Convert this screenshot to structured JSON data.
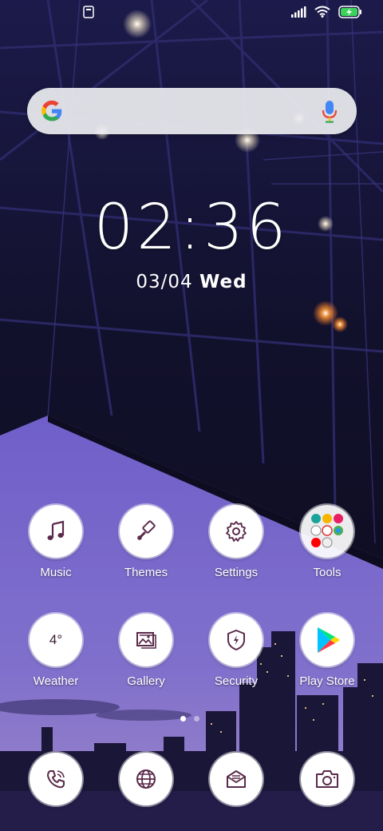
{
  "status": {
    "signal_icon": "signal-icon",
    "wifi_icon": "wifi-icon",
    "battery_icon": "battery-charging-icon",
    "battery_color": "#3bd35a"
  },
  "search": {
    "logo_icon": "google-g-icon",
    "mic_icon": "mic-icon"
  },
  "clock": {
    "time": "02:36",
    "date": "03/04",
    "weekday": "Wed"
  },
  "home_row1": [
    {
      "label": "Music",
      "icon": "music-note-icon"
    },
    {
      "label": "Themes",
      "icon": "paintbrush-icon"
    },
    {
      "label": "Settings",
      "icon": "gear-icon"
    },
    {
      "label": "Tools",
      "icon": "folder-icon"
    }
  ],
  "home_row2": [
    {
      "label": "Weather",
      "icon": "weather-icon",
      "value": "4°"
    },
    {
      "label": "Gallery",
      "icon": "gallery-icon"
    },
    {
      "label": "Security",
      "icon": "shield-icon"
    },
    {
      "label": "Play Store",
      "icon": "play-store-icon"
    }
  ],
  "dock": [
    {
      "icon": "phone-icon"
    },
    {
      "icon": "globe-icon"
    },
    {
      "icon": "message-icon"
    },
    {
      "icon": "camera-icon"
    }
  ],
  "pager": {
    "pages": 2,
    "active": 1
  },
  "colors": {
    "icon_stroke": "#5a2a4a",
    "sky": "#6a5cc8"
  }
}
